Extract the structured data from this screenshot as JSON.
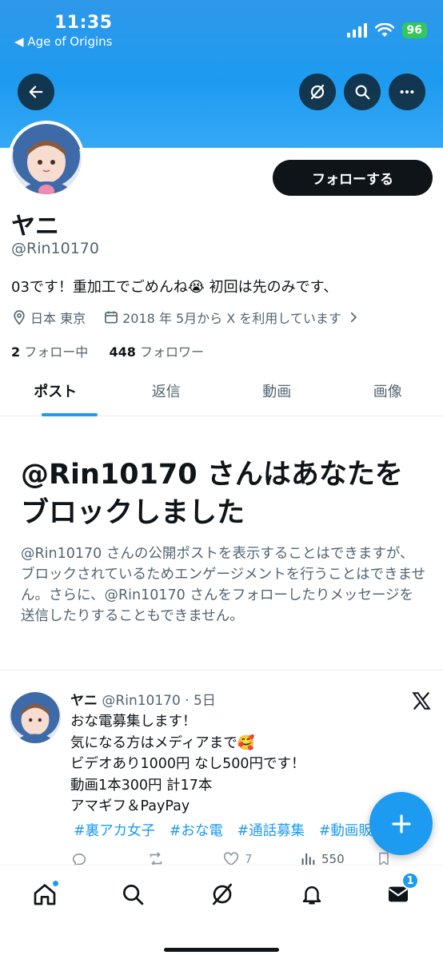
{
  "status_bar": {
    "time": "11:35",
    "back_app": "◀ Age of Origins",
    "battery": "96"
  },
  "header": {
    "back_icon": "arrow-left-icon",
    "actions": [
      "grok-icon",
      "search-icon",
      "more-icon"
    ]
  },
  "profile": {
    "display_name": "ヤニ",
    "handle": "@Rin10170",
    "bio": "03です！重加工でごめんね😭 初回は先のみです、",
    "location": "日本 東京",
    "joined": "2018 年 5月から X を利用しています",
    "following_count": "2",
    "following_label": "フォロー中",
    "followers_count": "448",
    "followers_label": "フォロワー",
    "follow_button": "フォローする"
  },
  "tabs": [
    {
      "label": "ポスト",
      "active": true
    },
    {
      "label": "返信",
      "active": false
    },
    {
      "label": "動画",
      "active": false
    },
    {
      "label": "画像",
      "active": false
    }
  ],
  "blocked": {
    "title_line1": "@Rin10170 さんはあなたを",
    "title_line2": "ブロックしました",
    "description": "@Rin10170 さんの公開ポストを表示することはできますが、ブロックされているためエンゲージメントを行うことはできません。さらに、@Rin10170 さんをフォローしたりメッセージを送信したりすることもできません。"
  },
  "tweet": {
    "name": "ヤニ",
    "handle_time": "@Rin10170 · 5日",
    "lines": [
      "おな電募集します！",
      "気になる方はメディアまで🥰",
      "ビデオあり1000円 なし500円です！",
      "動画1本300円 計17本",
      "アマギフ＆PayPay"
    ],
    "hashtags": [
      "#裏アカ女子",
      "#おな電",
      "#通話募集",
      "#動画販売"
    ],
    "likes": "7",
    "views": "550"
  },
  "bottom_nav": {
    "items": [
      "home-icon",
      "search-icon",
      "grok-icon",
      "notifications-icon",
      "messages-icon"
    ],
    "messages_badge": "1"
  },
  "colors": {
    "accent": "#1d9bf0",
    "banner": "#2f98e9",
    "text": "#0f1419",
    "secondary": "#536471"
  }
}
